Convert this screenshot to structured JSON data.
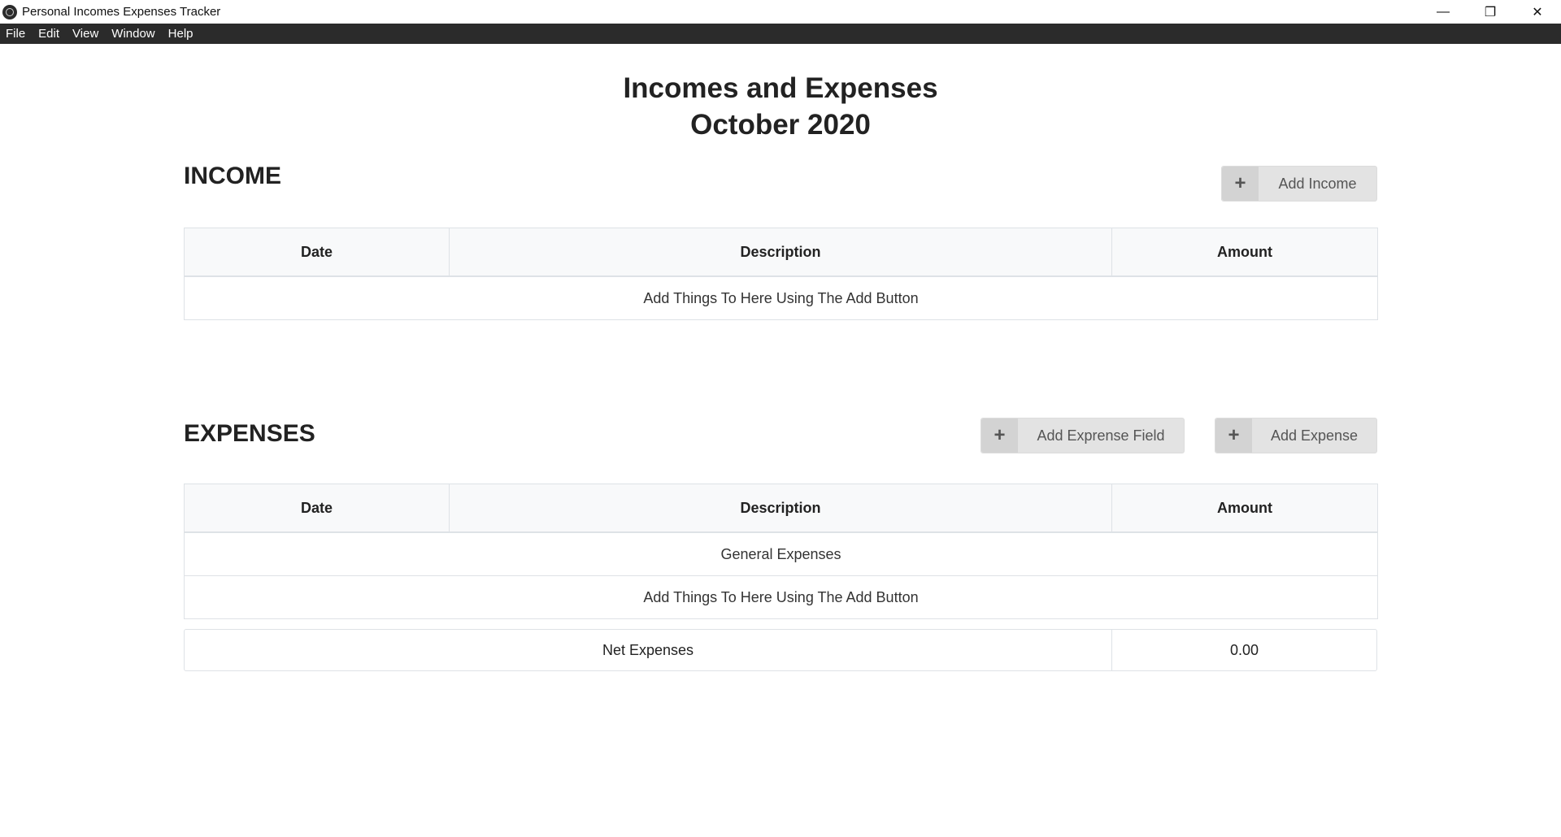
{
  "window": {
    "title": "Personal Incomes Expenses Tracker",
    "controls": {
      "minimize": "—",
      "restore": "❐",
      "close": "✕"
    }
  },
  "menu": [
    "File",
    "Edit",
    "View",
    "Window",
    "Help"
  ],
  "header": {
    "title_line1": "Incomes and Expenses",
    "title_line2": "October 2020"
  },
  "income": {
    "heading": "INCOME",
    "add_button": {
      "icon": "plus-icon",
      "glyph": "+",
      "label": "Add Income"
    },
    "columns": [
      "Date",
      "Description",
      "Amount"
    ],
    "empty_message": "Add Things To Here Using The Add Button"
  },
  "expenses": {
    "heading": "EXPENSES",
    "add_field_button": {
      "icon": "plus-icon",
      "glyph": "+",
      "label": "Add Exprense Field"
    },
    "add_button": {
      "icon": "plus-icon",
      "glyph": "+",
      "label": "Add Expense"
    },
    "columns": [
      "Date",
      "Description",
      "Amount"
    ],
    "group_label": "General Expenses",
    "empty_message": "Add Things To Here Using The Add Button",
    "net_label": "Net Expenses",
    "net_value": "0.00"
  },
  "colors": {
    "menubar": "#2b2b2b",
    "button_bg": "#e3e3e3",
    "button_icon_bg": "#d3d3d3",
    "table_border": "#dee2e6",
    "table_header_bg": "#f8f9fa"
  }
}
